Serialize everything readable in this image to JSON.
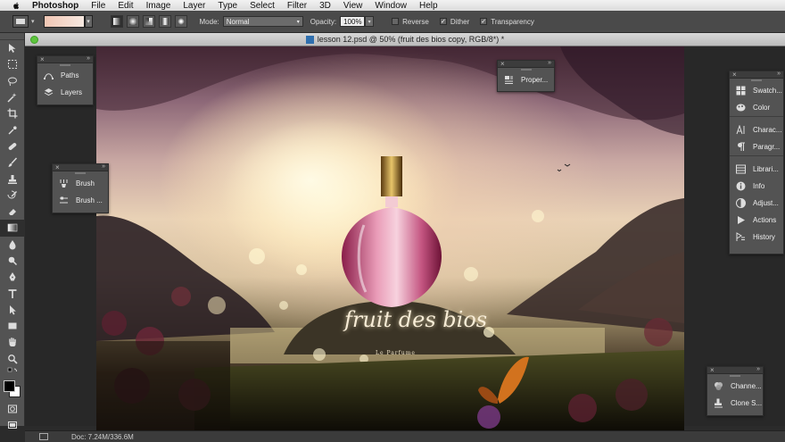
{
  "menubar": {
    "app_name": "Photoshop",
    "items": [
      "File",
      "Edit",
      "Image",
      "Layer",
      "Type",
      "Select",
      "Filter",
      "3D",
      "View",
      "Window",
      "Help"
    ]
  },
  "options": {
    "mode_label": "Mode:",
    "mode_value": "Normal",
    "opacity_label": "Opacity:",
    "opacity_value": "100%",
    "reverse_label": "Reverse",
    "dither_label": "Dither",
    "transparency_label": "Transparency",
    "reverse_checked": false,
    "dither_checked": true,
    "transparency_checked": true,
    "gradient_colors": [
      "#f1c6b4",
      "#f6e8e0"
    ]
  },
  "document": {
    "title": "lesson 12.psd @ 50% (fruit des bios copy, RGB/8*) *",
    "artwork_title": "fruit des bios",
    "artwork_subtitle": "Le Parfume"
  },
  "status": {
    "doc_info": "Doc: 7.24M/336.6M"
  },
  "panels": {
    "paths_layers": [
      "Paths",
      "Layers"
    ],
    "brush": [
      "Brush",
      "Brush ..."
    ],
    "properties": [
      "Proper..."
    ],
    "right_dock": [
      "Swatch...",
      "Color",
      "Charac...",
      "Paragr...",
      "Librari...",
      "Info",
      "Adjust...",
      "Actions",
      "History"
    ],
    "channels": [
      "Channe...",
      "Clone S..."
    ]
  },
  "icons": {
    "apple": "apple-logo-icon",
    "doc_type": "psd-file-icon"
  },
  "colors": {
    "panel_bg": "#535353",
    "workspace_bg": "#282828",
    "close_dot": "#5dc43d"
  }
}
